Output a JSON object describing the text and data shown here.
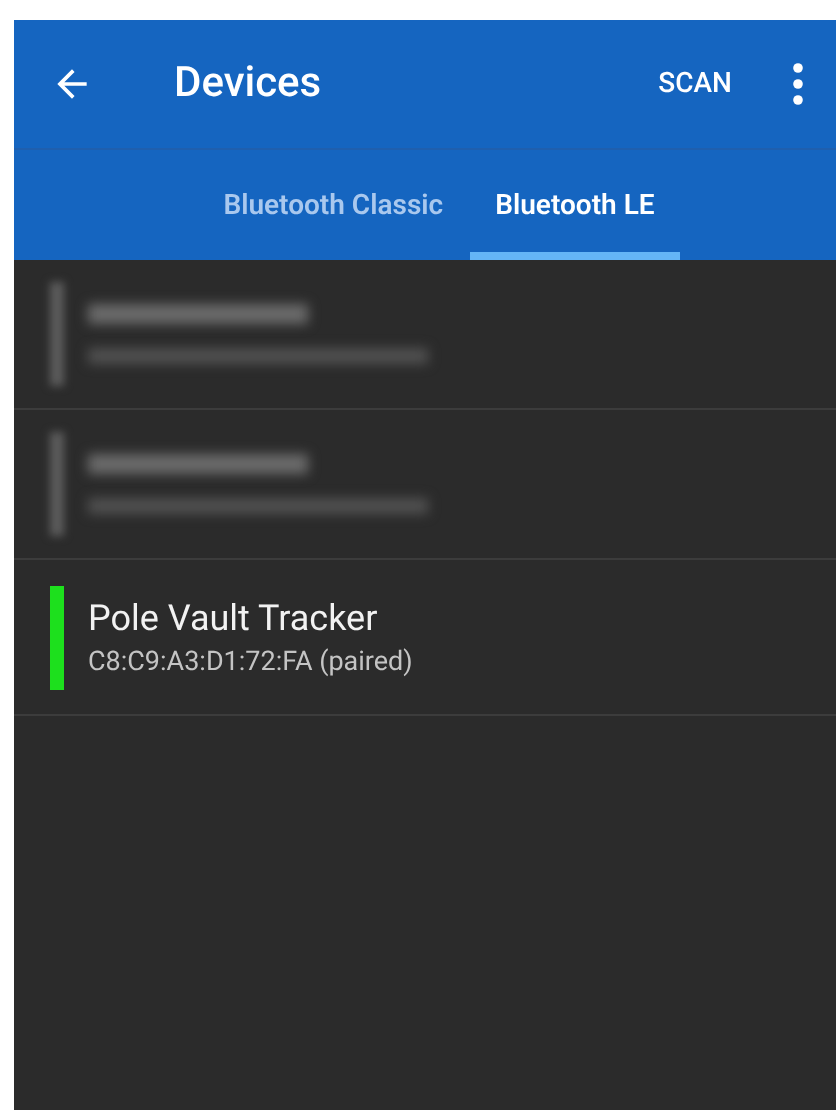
{
  "app_bar": {
    "title": "Devices",
    "action": "SCAN"
  },
  "tabs": [
    {
      "label": "Bluetooth Classic",
      "selected": false
    },
    {
      "label": "Bluetooth LE",
      "selected": true
    }
  ],
  "devices": [
    {
      "kind": "blurred",
      "color": "#5c5c5c"
    },
    {
      "kind": "blurred",
      "color": "#5c5c5c"
    },
    {
      "kind": "device",
      "name": "Pole Vault Tracker",
      "address": "C8:C9:A3:D1:72:FA (paired)",
      "color": "#1de01d"
    }
  ]
}
